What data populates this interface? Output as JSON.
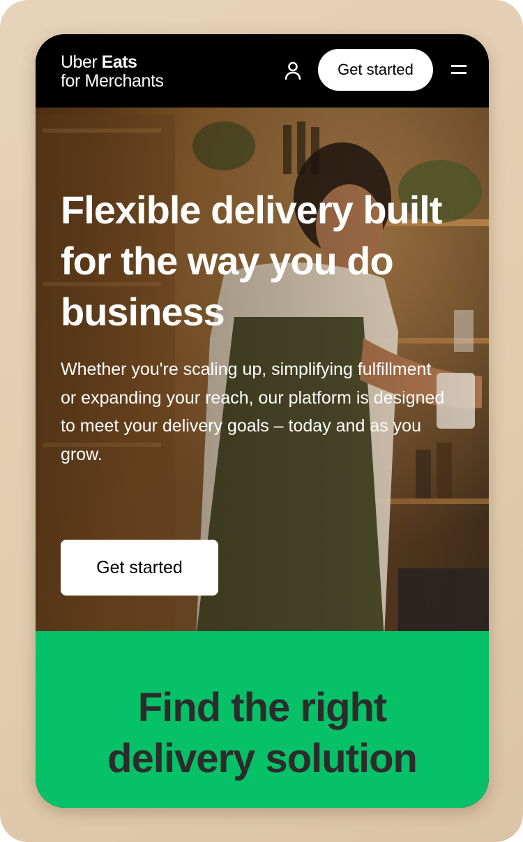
{
  "nav": {
    "logo_line1_light": "Uber ",
    "logo_line1_bold": "Eats",
    "logo_line2": "for Merchants",
    "account_icon": "user-icon",
    "cta_label": "Get started",
    "menu_icon": "hamburger-menu-icon"
  },
  "hero": {
    "title": "Flexible delivery built for the way you do business",
    "subtitle": "Whether you're scaling up, simplifying fulfillment or expanding your reach, our platform is designed to meet your delivery goals – today and as you grow.",
    "cta_label": "Get started"
  },
  "solutions": {
    "title_line1": "Find the right",
    "title_line2": "delivery solution"
  },
  "colors": {
    "nav_background": "#000000",
    "accent_green": "#06c167",
    "button_background": "#ffffff",
    "heading_dark": "#2c2c2c"
  }
}
